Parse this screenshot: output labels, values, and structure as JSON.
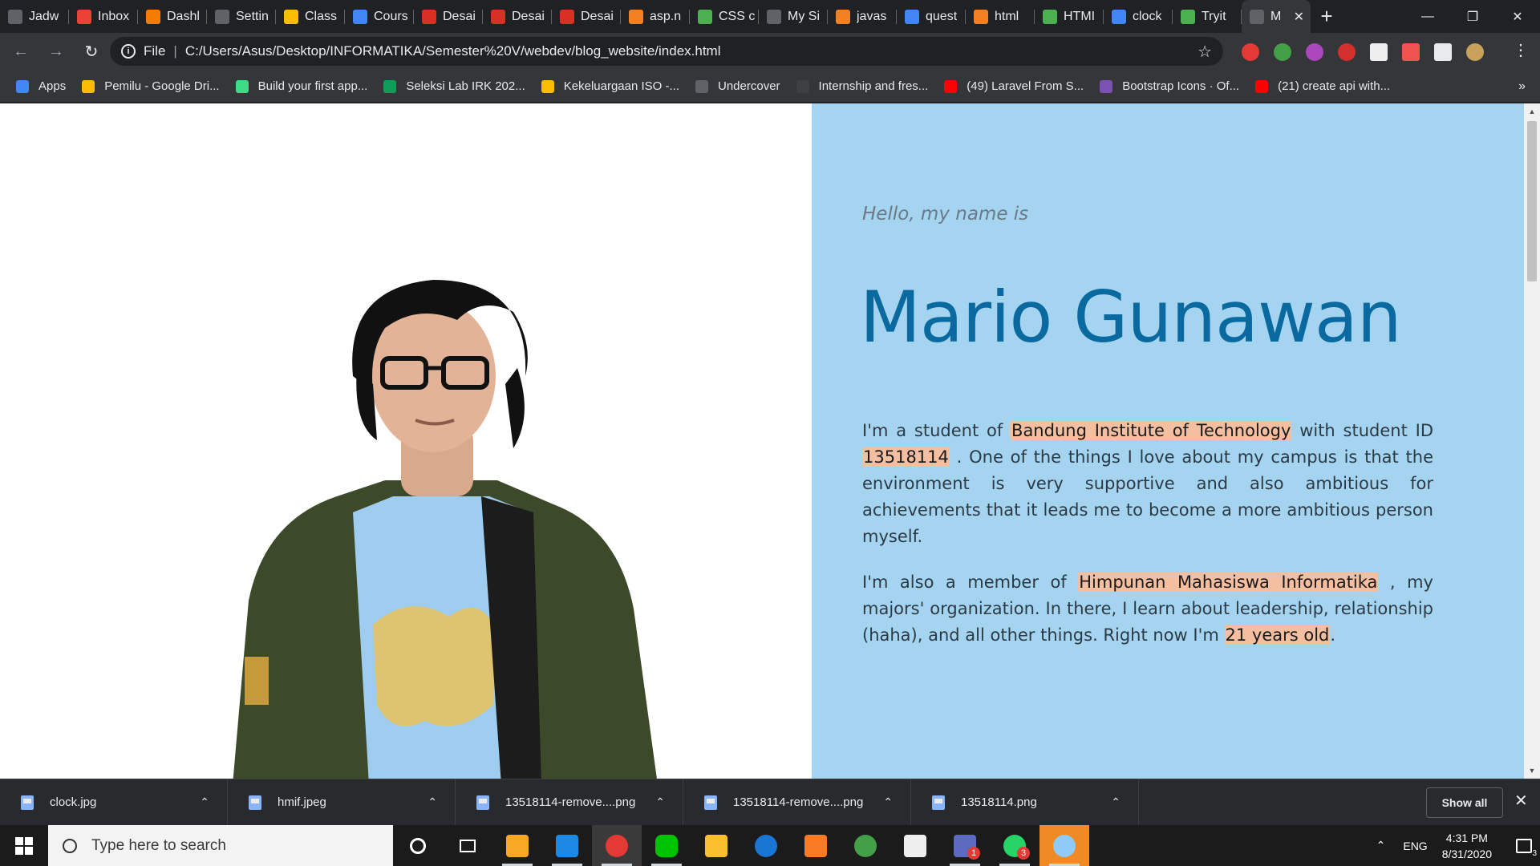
{
  "tabs": [
    {
      "title": "Jadw",
      "color": "#5f6368",
      "icon": "app-icon"
    },
    {
      "title": "Inbox",
      "color": "#ea4335",
      "icon": "gmail-icon"
    },
    {
      "title": "Dashl",
      "color": "#f57c00",
      "icon": "moodle-icon"
    },
    {
      "title": "Settin",
      "color": "#5f6368",
      "icon": "gear-icon"
    },
    {
      "title": "Class",
      "color": "#fbbc04",
      "icon": "classroom-icon"
    },
    {
      "title": "Cours",
      "color": "#4285f4",
      "icon": "course-icon"
    },
    {
      "title": "Desai",
      "color": "#d93025",
      "icon": "doc-icon"
    },
    {
      "title": "Desai",
      "color": "#d93025",
      "icon": "doc-icon"
    },
    {
      "title": "Desai",
      "color": "#d93025",
      "icon": "doc-icon"
    },
    {
      "title": "asp.n",
      "color": "#f48024",
      "icon": "stackoverflow-icon"
    },
    {
      "title": "CSS c",
      "color": "#4caf50",
      "icon": "w3schools-icon"
    },
    {
      "title": "My Si",
      "color": "#5f6368",
      "icon": "globe-icon"
    },
    {
      "title": "javas",
      "color": "#f48024",
      "icon": "stackoverflow-icon"
    },
    {
      "title": "quest",
      "color": "#4285f4",
      "icon": "google-icon"
    },
    {
      "title": "html",
      "color": "#f48024",
      "icon": "stackoverflow-icon"
    },
    {
      "title": "HTMI",
      "color": "#4caf50",
      "icon": "w3schools-icon"
    },
    {
      "title": "clock",
      "color": "#4285f4",
      "icon": "google-icon"
    },
    {
      "title": "Tryit",
      "color": "#4caf50",
      "icon": "w3schools-icon"
    },
    {
      "title": "M",
      "color": "#5f6368",
      "icon": "globe-icon"
    }
  ],
  "omnibox": {
    "scheme": "File",
    "url": "C:/Users/Asus/Desktop/INFORMATIKA/Semester%20V/webdev/blog_website/index.html"
  },
  "bookmarks": [
    {
      "label": "Apps",
      "color": "#4285f4",
      "icon": "apps-grid-icon"
    },
    {
      "label": "Pemilu - Google Dri...",
      "color": "#fbbc04",
      "icon": "drive-icon"
    },
    {
      "label": "Build your first app...",
      "color": "#3ddc84",
      "icon": "android-icon"
    },
    {
      "label": "Seleksi Lab IRK 202...",
      "color": "#0f9d58",
      "icon": "forms-icon"
    },
    {
      "label": "Kekeluargaan ISO -...",
      "color": "#fbbc04",
      "icon": "drive-icon"
    },
    {
      "label": "Undercover",
      "color": "#5f6368",
      "icon": "globe-icon"
    },
    {
      "label": "Internship and fres...",
      "color": "#3c4043",
      "icon": "site-icon"
    },
    {
      "label": "(49) Laravel From S...",
      "color": "#ff0000",
      "icon": "youtube-icon"
    },
    {
      "label": "Bootstrap Icons · Of...",
      "color": "#7952b3",
      "icon": "bootstrap-icon"
    },
    {
      "label": "(21) create api with...",
      "color": "#ff0000",
      "icon": "youtube-icon"
    }
  ],
  "page": {
    "greeting": "Hello, my name is",
    "name": "Mario Gunawan",
    "p1": {
      "t1": "I'm a student of ",
      "h1": "Bandung Institute of Technology",
      "t2": " with student ID ",
      "h2": "13518114",
      "t3": " . One of the things I love about my campus is that the environment is very supportive and also ambitious for achievements that it leads me to become a more ambitious person myself."
    },
    "p2": {
      "t1": "I'm also a member of ",
      "h1": "Himpunan Mahasiswa Informatika",
      "t2": " , my majors' organization. In there, I learn about leadership, relationship (haha), and all other things. Right now I'm ",
      "h2": "21 years old",
      "t3": "."
    },
    "colors": {
      "panel": "#a5d4f0",
      "name": "#0a6aa0",
      "highlight": "#f4bfa0"
    }
  },
  "downloads": [
    {
      "file": "clock.jpg"
    },
    {
      "file": "hmif.jpeg"
    },
    {
      "file": "13518114-remove....png"
    },
    {
      "file": "13518114-remove....png"
    },
    {
      "file": "13518114.png"
    }
  ],
  "shelf": {
    "show_all": "Show all"
  },
  "taskbar": {
    "search_placeholder": "Type here to search",
    "lang": "ENG",
    "time": "4:31 PM",
    "date": "8/31/2020",
    "teams_badge": "1",
    "whatsapp_badge": "3",
    "notif_count": "3"
  }
}
